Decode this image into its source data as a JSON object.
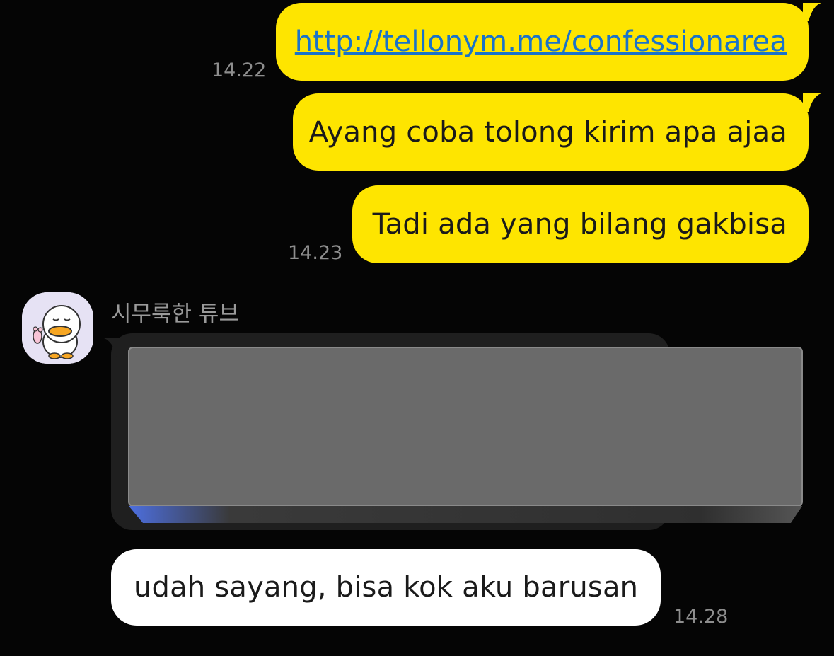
{
  "messages": {
    "m1": {
      "text": "http://tellonym.me/confessionarea",
      "time": "14.22"
    },
    "m2": {
      "text": "Ayang coba tolong kirim apa ajaa"
    },
    "m3": {
      "text": "Tadi ada yang bilang gakbisa",
      "time": "14.23"
    },
    "reply": {
      "text": "udah sayang, bisa kok aku barusan",
      "time": "14.28"
    }
  },
  "sender": {
    "name": "시무룩한 튜브"
  },
  "icons": {
    "avatar": "sad-duck-avatar-icon"
  },
  "colors": {
    "my_bubble": "#fee500",
    "their_bubble": "#ffffff",
    "background": "#050505",
    "link": "#1a73c9",
    "timestamp": "#8e8e8e"
  }
}
